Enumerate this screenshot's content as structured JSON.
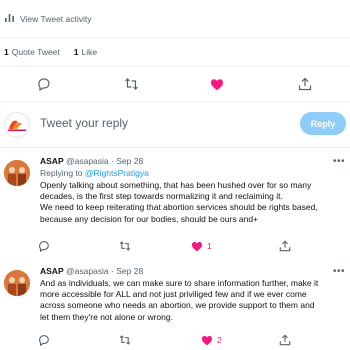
{
  "activity": {
    "label": "View Tweet activity",
    "icon": "bar-chart-icon"
  },
  "stats": [
    {
      "count": "1",
      "label": "Quote Tweet"
    },
    {
      "count": "1",
      "label": "Like"
    }
  ],
  "actions": {
    "icons": [
      "reply-icon",
      "retweet-icon",
      "like-icon",
      "share-icon"
    ],
    "like_color": "#f91880"
  },
  "composer": {
    "placeholder": "Tweet your reply",
    "button_label": "Reply",
    "avatar": "rights-pratigya-logo"
  },
  "replies": [
    {
      "name": "ASAP",
      "handle": "@asapasia",
      "date": "Sep 28",
      "replying_prefix": "Replying to",
      "replying_to": "@RightsPratigya",
      "text_lines": [
        "Openly talking about something, that has been hushed over for so many",
        "decades, is the first step towards normalizing it and reclaiming it.",
        "We need to keep reiterating that abortion services should be rights based,",
        "because any decision for our bodies, should be ours and+"
      ],
      "like_count": "1"
    },
    {
      "name": "ASAP",
      "handle": "@asapasia",
      "date": "Sep 28",
      "text_lines": [
        "And as individuals, we can make sure to share information further, make it",
        "more accessible for ALL and not just priviliged few and if we ever come",
        "across someone who needs an abortion, we provide support to them and",
        "let them they're not alone or wrong."
      ],
      "like_count": "2"
    }
  ]
}
